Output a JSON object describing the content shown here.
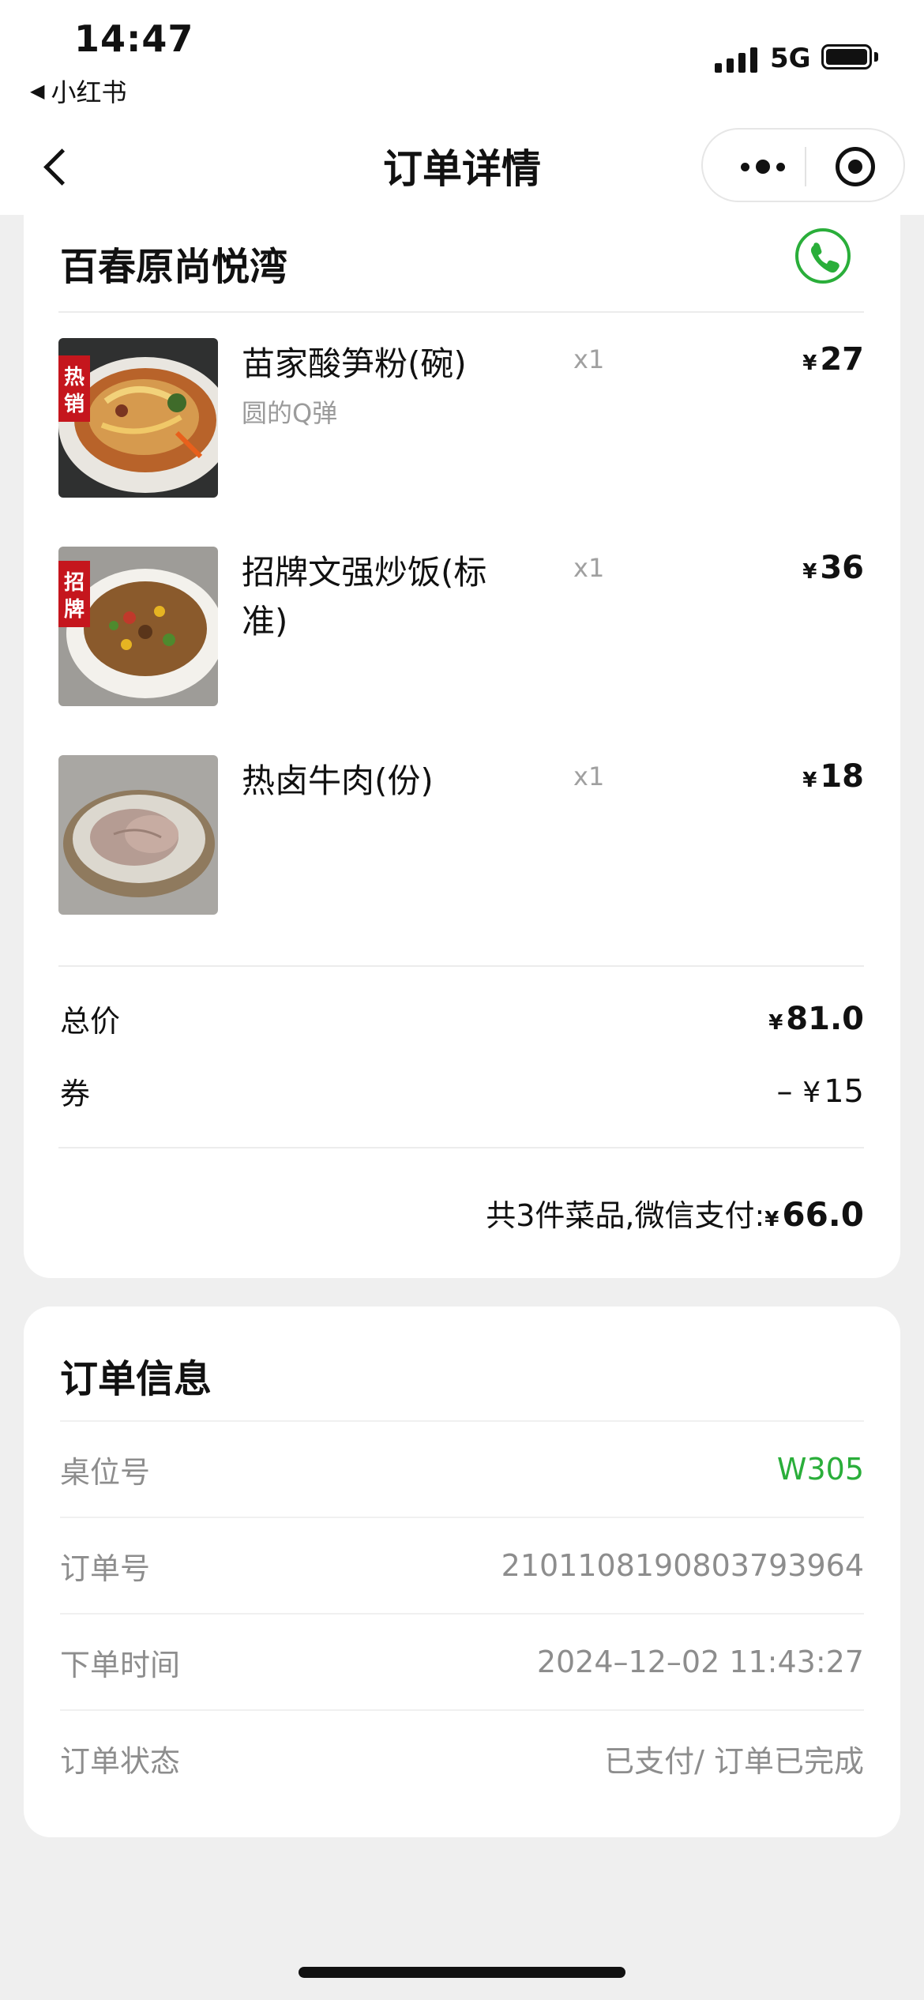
{
  "status_bar": {
    "time": "14:47",
    "back_app": "小红书",
    "network": "5G"
  },
  "nav": {
    "title": "订单详情"
  },
  "shop": {
    "name": "百春原尚悦湾"
  },
  "items": [
    {
      "name": "苗家酸笋粉(碗)",
      "spec": "圆的Q弹",
      "qty": "x1",
      "currency": "¥",
      "price": "27",
      "thumb_badge": "热销"
    },
    {
      "name": "招牌文强炒饭(标准)",
      "spec": "",
      "qty": "x1",
      "currency": "¥",
      "price": "36",
      "thumb_badge": "招牌"
    },
    {
      "name": "热卤牛肉(份)",
      "spec": "",
      "qty": "x1",
      "currency": "¥",
      "price": "18",
      "thumb_badge": ""
    }
  ],
  "summary": {
    "total_label": "总价",
    "total_currency": "¥",
    "total_value": "81.0",
    "coupon_label": "券",
    "coupon_prefix": "–",
    "coupon_currency": "¥",
    "coupon_value": "15",
    "footer_text": "共3件菜品,微信支付:",
    "footer_currency": "¥",
    "footer_amount": "66.0"
  },
  "order_info": {
    "title": "订单信息",
    "rows": [
      {
        "label": "桌位号",
        "value": "W305"
      },
      {
        "label": "订单号",
        "value": "2101108190803793964"
      },
      {
        "label": "下单时间",
        "value": "2024–12–02 11:43:27"
      },
      {
        "label": "订单状态",
        "value": "已支付/ 订单已完成"
      }
    ]
  },
  "colors": {
    "accent_green": "#2aae3a",
    "page_bg": "#efefef",
    "muted_text": "#8d8d8d"
  },
  "icons": [
    "back-chevron-icon",
    "more-dots-icon",
    "target-icon",
    "phone-icon"
  ]
}
